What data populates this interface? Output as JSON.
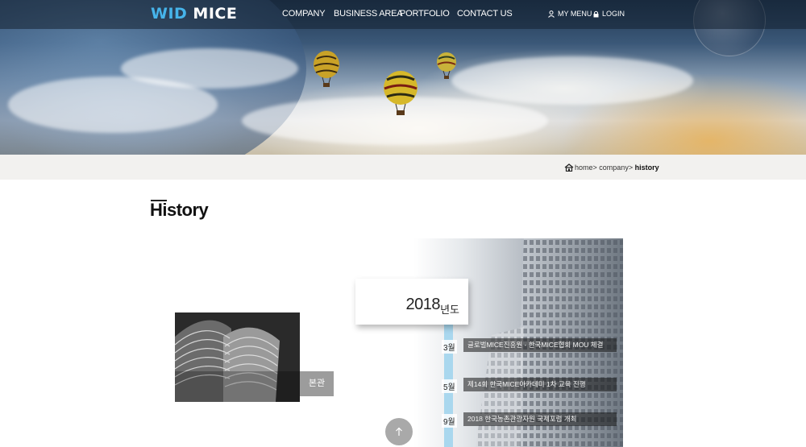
{
  "header": {
    "logo_part1": "WID",
    "logo_part2": " MICE",
    "nav": [
      {
        "label": "COMPANY"
      },
      {
        "label": "BUSINESS AREA"
      },
      {
        "label": "PORTFOLIO"
      },
      {
        "label": "CONTACT US"
      }
    ],
    "utility": {
      "my_menu": "MY MENU",
      "login": "LOGIN"
    }
  },
  "breadcrumb": {
    "home": "home",
    "sep": ">",
    "company": "company",
    "current": "history"
  },
  "page": {
    "title": "History"
  },
  "history": {
    "year": "2018",
    "year_suffix": "년도",
    "entries": [
      {
        "month": "3월",
        "text": "글로벌MICE진흥원 - 한국MICE협회 MOU 체결"
      },
      {
        "month": "5월",
        "text": "제14회 한국MICE아카데미 1차 교육 진행"
      },
      {
        "month": "9월",
        "text": "2018 한국농촌관광자원 국제포럼 개최"
      }
    ]
  },
  "side_card": {
    "label": "본관"
  },
  "colors": {
    "logo_accent": "#46b4ea",
    "timeline": "#a9d7ee",
    "breadcrumb_bg": "#f2f1ef"
  },
  "icons": {
    "home": "home-icon",
    "user": "user-icon",
    "lock": "lock-icon",
    "scroll_top": "arrow-up-icon"
  }
}
